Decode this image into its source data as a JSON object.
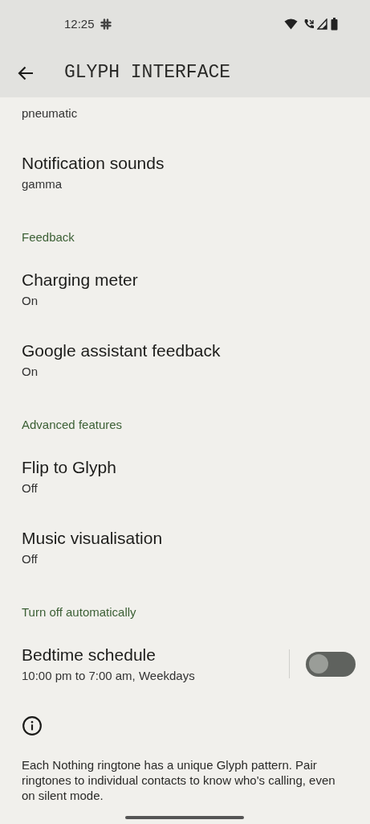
{
  "status_bar": {
    "time": "12:25"
  },
  "app_bar": {
    "title": "GLYPH INTERFACE"
  },
  "items": [
    {
      "kind": "setting",
      "subtitle": "pneumatic"
    },
    {
      "kind": "setting",
      "title": "Notification sounds",
      "subtitle": "gamma"
    },
    {
      "kind": "section",
      "label": "Feedback"
    },
    {
      "kind": "setting",
      "title": "Charging meter",
      "subtitle": "On"
    },
    {
      "kind": "setting",
      "title": "Google assistant feedback",
      "subtitle": "On"
    },
    {
      "kind": "section",
      "label": "Advanced features"
    },
    {
      "kind": "setting",
      "title": "Flip to Glyph",
      "subtitle": "Off"
    },
    {
      "kind": "setting",
      "title": "Music visualisation",
      "subtitle": "Off"
    },
    {
      "kind": "section",
      "label": "Turn off automatically"
    },
    {
      "kind": "switch",
      "title": "Bedtime schedule",
      "subtitle": "10:00 pm to 7:00 am, Weekdays",
      "on": false
    }
  ],
  "footer": {
    "text": "Each Nothing ringtone has a unique Glyph pattern. Pair ringtones to individual contacts to know who's calling, even on silent mode."
  }
}
